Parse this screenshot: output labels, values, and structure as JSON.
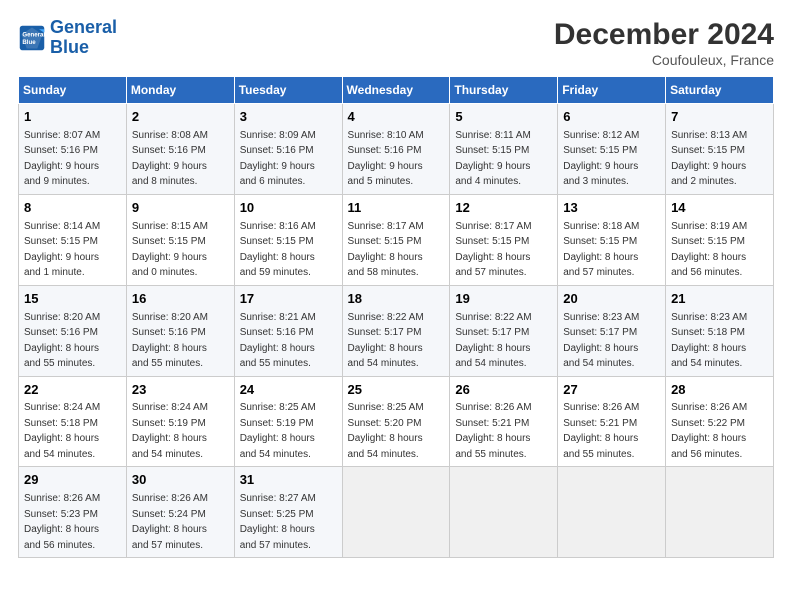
{
  "logo": {
    "line1": "General",
    "line2": "Blue"
  },
  "title": "December 2024",
  "subtitle": "Coufouleux, France",
  "days_of_week": [
    "Sunday",
    "Monday",
    "Tuesday",
    "Wednesday",
    "Thursday",
    "Friday",
    "Saturday"
  ],
  "weeks": [
    [
      {
        "day": "1",
        "info": "Sunrise: 8:07 AM\nSunset: 5:16 PM\nDaylight: 9 hours\nand 9 minutes."
      },
      {
        "day": "2",
        "info": "Sunrise: 8:08 AM\nSunset: 5:16 PM\nDaylight: 9 hours\nand 8 minutes."
      },
      {
        "day": "3",
        "info": "Sunrise: 8:09 AM\nSunset: 5:16 PM\nDaylight: 9 hours\nand 6 minutes."
      },
      {
        "day": "4",
        "info": "Sunrise: 8:10 AM\nSunset: 5:16 PM\nDaylight: 9 hours\nand 5 minutes."
      },
      {
        "day": "5",
        "info": "Sunrise: 8:11 AM\nSunset: 5:15 PM\nDaylight: 9 hours\nand 4 minutes."
      },
      {
        "day": "6",
        "info": "Sunrise: 8:12 AM\nSunset: 5:15 PM\nDaylight: 9 hours\nand 3 minutes."
      },
      {
        "day": "7",
        "info": "Sunrise: 8:13 AM\nSunset: 5:15 PM\nDaylight: 9 hours\nand 2 minutes."
      }
    ],
    [
      {
        "day": "8",
        "info": "Sunrise: 8:14 AM\nSunset: 5:15 PM\nDaylight: 9 hours\nand 1 minute."
      },
      {
        "day": "9",
        "info": "Sunrise: 8:15 AM\nSunset: 5:15 PM\nDaylight: 9 hours\nand 0 minutes."
      },
      {
        "day": "10",
        "info": "Sunrise: 8:16 AM\nSunset: 5:15 PM\nDaylight: 8 hours\nand 59 minutes."
      },
      {
        "day": "11",
        "info": "Sunrise: 8:17 AM\nSunset: 5:15 PM\nDaylight: 8 hours\nand 58 minutes."
      },
      {
        "day": "12",
        "info": "Sunrise: 8:17 AM\nSunset: 5:15 PM\nDaylight: 8 hours\nand 57 minutes."
      },
      {
        "day": "13",
        "info": "Sunrise: 8:18 AM\nSunset: 5:15 PM\nDaylight: 8 hours\nand 57 minutes."
      },
      {
        "day": "14",
        "info": "Sunrise: 8:19 AM\nSunset: 5:15 PM\nDaylight: 8 hours\nand 56 minutes."
      }
    ],
    [
      {
        "day": "15",
        "info": "Sunrise: 8:20 AM\nSunset: 5:16 PM\nDaylight: 8 hours\nand 55 minutes."
      },
      {
        "day": "16",
        "info": "Sunrise: 8:20 AM\nSunset: 5:16 PM\nDaylight: 8 hours\nand 55 minutes."
      },
      {
        "day": "17",
        "info": "Sunrise: 8:21 AM\nSunset: 5:16 PM\nDaylight: 8 hours\nand 55 minutes."
      },
      {
        "day": "18",
        "info": "Sunrise: 8:22 AM\nSunset: 5:17 PM\nDaylight: 8 hours\nand 54 minutes."
      },
      {
        "day": "19",
        "info": "Sunrise: 8:22 AM\nSunset: 5:17 PM\nDaylight: 8 hours\nand 54 minutes."
      },
      {
        "day": "20",
        "info": "Sunrise: 8:23 AM\nSunset: 5:17 PM\nDaylight: 8 hours\nand 54 minutes."
      },
      {
        "day": "21",
        "info": "Sunrise: 8:23 AM\nSunset: 5:18 PM\nDaylight: 8 hours\nand 54 minutes."
      }
    ],
    [
      {
        "day": "22",
        "info": "Sunrise: 8:24 AM\nSunset: 5:18 PM\nDaylight: 8 hours\nand 54 minutes."
      },
      {
        "day": "23",
        "info": "Sunrise: 8:24 AM\nSunset: 5:19 PM\nDaylight: 8 hours\nand 54 minutes."
      },
      {
        "day": "24",
        "info": "Sunrise: 8:25 AM\nSunset: 5:19 PM\nDaylight: 8 hours\nand 54 minutes."
      },
      {
        "day": "25",
        "info": "Sunrise: 8:25 AM\nSunset: 5:20 PM\nDaylight: 8 hours\nand 54 minutes."
      },
      {
        "day": "26",
        "info": "Sunrise: 8:26 AM\nSunset: 5:21 PM\nDaylight: 8 hours\nand 55 minutes."
      },
      {
        "day": "27",
        "info": "Sunrise: 8:26 AM\nSunset: 5:21 PM\nDaylight: 8 hours\nand 55 minutes."
      },
      {
        "day": "28",
        "info": "Sunrise: 8:26 AM\nSunset: 5:22 PM\nDaylight: 8 hours\nand 56 minutes."
      }
    ],
    [
      {
        "day": "29",
        "info": "Sunrise: 8:26 AM\nSunset: 5:23 PM\nDaylight: 8 hours\nand 56 minutes."
      },
      {
        "day": "30",
        "info": "Sunrise: 8:26 AM\nSunset: 5:24 PM\nDaylight: 8 hours\nand 57 minutes."
      },
      {
        "day": "31",
        "info": "Sunrise: 8:27 AM\nSunset: 5:25 PM\nDaylight: 8 hours\nand 57 minutes."
      },
      null,
      null,
      null,
      null
    ]
  ]
}
